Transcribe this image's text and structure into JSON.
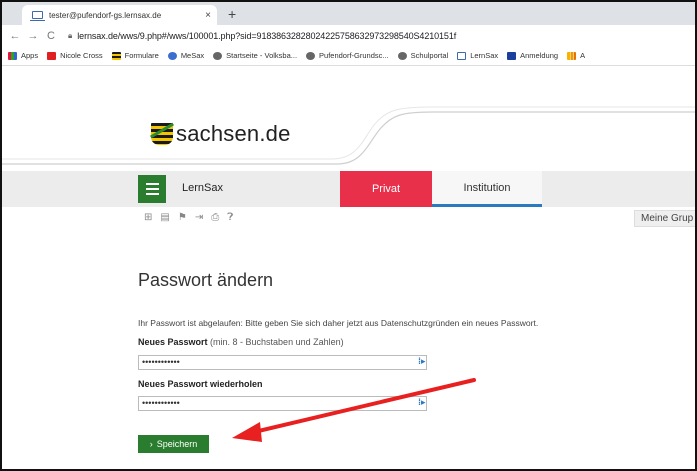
{
  "browser": {
    "tab_title": "tester@pufendorf-gs.lernsax.de",
    "tab_close": "×",
    "new_tab": "+",
    "url": "lernsax.de/wws/9.php#/wws/100001.php?sid=91838632828024225758632973298540S4210151f",
    "bookmarks": [
      "Apps",
      "Nicole Cross",
      "Formulare",
      "MeSax",
      "Startseite - Volksba...",
      "Pufendorf-Grundsc...",
      "Schulportal",
      "LernSax",
      "Anmeldung",
      "A"
    ]
  },
  "site": {
    "brand": "sachsen.de"
  },
  "menu": {
    "app_name": "LernSax",
    "tab_privat": "Privat",
    "tab_institution": "Institution",
    "groups_label": "Meine Grup"
  },
  "form": {
    "title": "Passwort ändern",
    "info": "Ihr Passwort ist abgelaufen: Bitte geben Sie sich daher jetzt aus Datenschutzgründen ein neues Passwort.",
    "new_pw_label": "Neues Passwort",
    "new_pw_hint": " (min. 8 - Buchstaben und Zahlen)",
    "new_pw_value": "••••••••••••",
    "repeat_pw_label": "Neues Passwort wiederholen",
    "repeat_pw_value": "••••••••••••",
    "save_label": "Speichern"
  },
  "colors": {
    "green": "#2a7d2e",
    "red": "#e8304a",
    "blue": "#2a7ac0",
    "annotation_arrow": "#e82020"
  }
}
